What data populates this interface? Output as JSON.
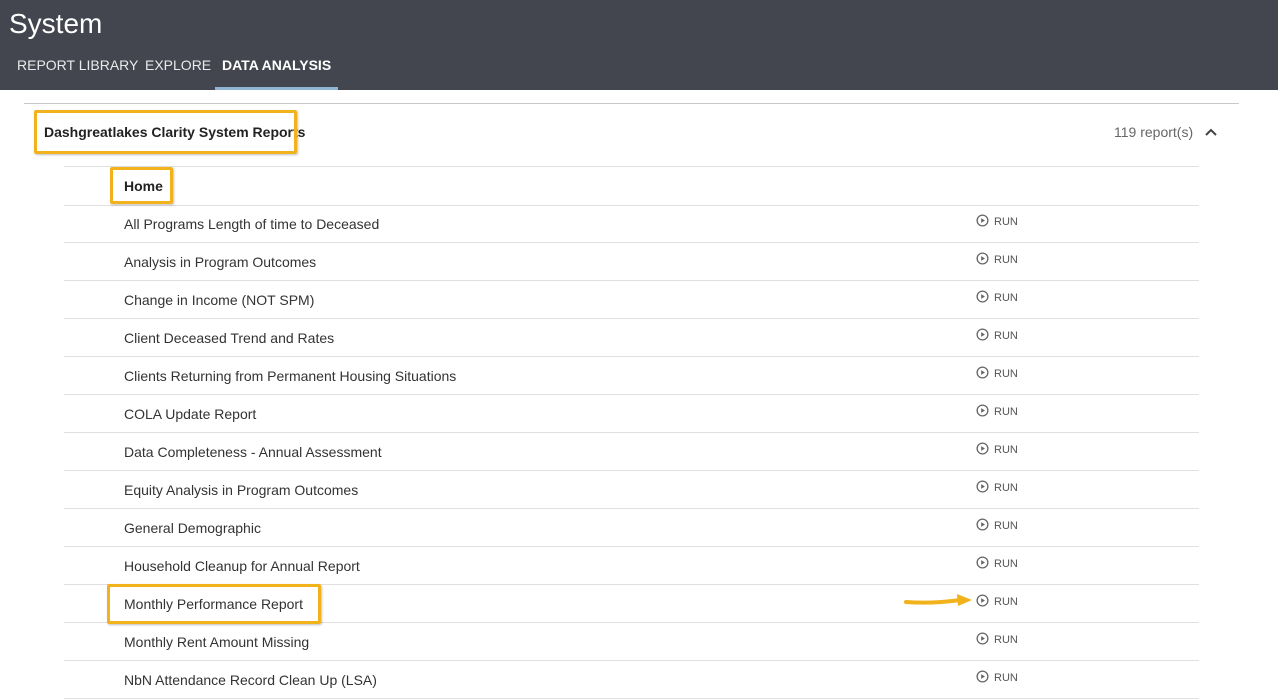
{
  "app": {
    "title": "System"
  },
  "tabs": [
    {
      "label": "REPORT LIBRARY",
      "active": false
    },
    {
      "label": "EXPLORE",
      "active": false
    },
    {
      "label": "DATA ANALYSIS",
      "active": true
    }
  ],
  "group": {
    "title": "Dashgreatlakes Clarity System Reports",
    "count": "119 report(s)",
    "toggle_icon": "chevron-up-icon"
  },
  "folder": {
    "name": "Home"
  },
  "run_label": "RUN",
  "run_icon": "play-circle-icon",
  "reports": [
    "All Programs Length of time to Deceased",
    "Analysis in Program Outcomes",
    "Change in Income (NOT SPM)",
    "Client Deceased Trend and Rates",
    "Clients Returning from Permanent Housing Situations",
    "COLA Update Report",
    "Data Completeness - Annual Assessment",
    "Equity Analysis in Program Outcomes",
    "General Demographic",
    "Household Cleanup for Annual Report",
    "Monthly Performance Report",
    "Monthly Rent Amount Missing",
    "NbN Attendance Record Clean Up (LSA)"
  ],
  "colors": {
    "topbar": "#43464e",
    "highlight": "#f2b21b",
    "active_tab_underline": "#8fb4d4"
  }
}
